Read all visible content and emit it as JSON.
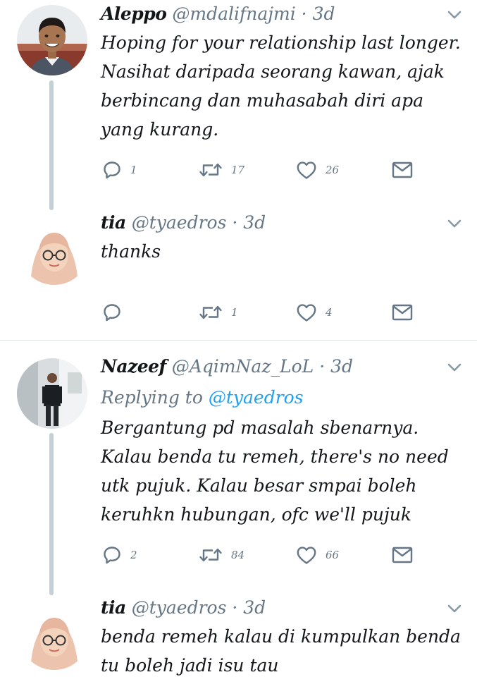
{
  "tweets": [
    {
      "name": "Aleppo",
      "handle": "@mdalifnajmi",
      "separator": "·",
      "time": "3d",
      "text": "Hoping for your relationship last longer. Nasihat daripada seorang kawan, ajak berbincang dan muhasabah diri apa yang kurang.",
      "replies": "1",
      "retweets": "17",
      "likes": "26"
    },
    {
      "name": "tia",
      "handle": "@tyaedros",
      "separator": "·",
      "time": "3d",
      "text": "thanks",
      "replies": "",
      "retweets": "1",
      "likes": "4"
    },
    {
      "name": "Nazeef",
      "handle": "@AqimNaz_LoL",
      "separator": "·",
      "time": "3d",
      "reply_prefix": "Replying to",
      "reply_target": "@tyaedros",
      "text": "Bergantung pd masalah sbenarnya. Kalau benda tu remeh, there's no need utk pujuk. Kalau besar smpai boleh keruhkn hubungan, ofc we'll pujuk",
      "replies": "2",
      "retweets": "84",
      "likes": "66"
    },
    {
      "name": "tia",
      "handle": "@tyaedros",
      "separator": "·",
      "time": "3d",
      "text": "benda remeh kalau di kumpulkan benda tu boleh jadi isu tau"
    }
  ],
  "colors": {
    "text": "#14171a",
    "secondary": "#657786",
    "link": "#1da1f2",
    "thread_line": "#c4cfd6",
    "divider": "#e1e8ed"
  }
}
